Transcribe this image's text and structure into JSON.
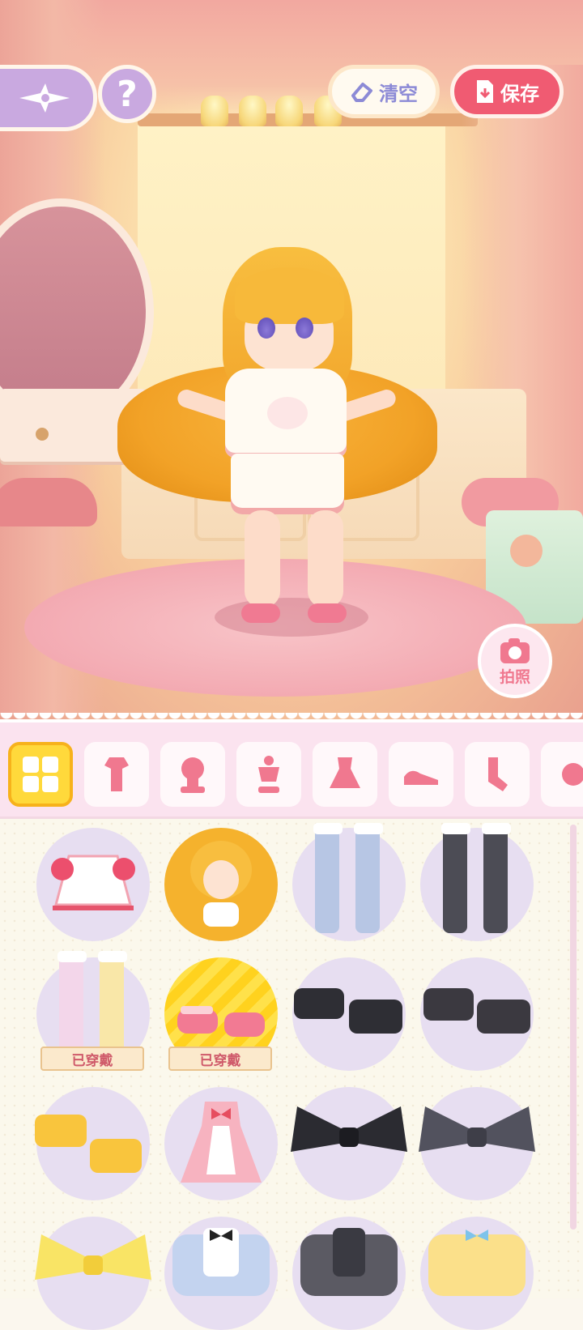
{
  "header": {
    "clear_label": "清空",
    "save_label": "保存",
    "help_label": "?"
  },
  "scene": {
    "photo_label": "拍照"
  },
  "categories": [
    {
      "icon": "all-items-icon",
      "active": true
    },
    {
      "icon": "outfit-set-icon",
      "active": false
    },
    {
      "icon": "hair-icon",
      "active": false
    },
    {
      "icon": "top-icon",
      "active": false
    },
    {
      "icon": "dress-icon",
      "active": false
    },
    {
      "icon": "shoes-icon",
      "active": false
    },
    {
      "icon": "socks-icon",
      "active": false
    },
    {
      "icon": "accessory-icon",
      "active": false
    }
  ],
  "items": [
    {
      "name": "pink-white-dress",
      "worn": false,
      "selected": false
    },
    {
      "name": "long-blonde-hair",
      "worn": false,
      "selected": false
    },
    {
      "name": "blue-argyle-stockings",
      "worn": false,
      "selected": false
    },
    {
      "name": "black-argyle-stockings",
      "worn": false,
      "selected": false
    },
    {
      "name": "pastel-argyle-stockings",
      "worn": true,
      "selected": false
    },
    {
      "name": "pink-slippers",
      "worn": true,
      "selected": true
    },
    {
      "name": "black-bow-boots",
      "worn": false,
      "selected": false
    },
    {
      "name": "dark-bow-boots",
      "worn": false,
      "selected": false
    },
    {
      "name": "yellow-bow-shoes",
      "worn": false,
      "selected": false
    },
    {
      "name": "pink-maid-dress",
      "worn": false,
      "selected": false
    },
    {
      "name": "black-hair-bow",
      "worn": false,
      "selected": false
    },
    {
      "name": "gray-hair-bow",
      "worn": false,
      "selected": false
    },
    {
      "name": "yellow-hair-bow",
      "worn": false,
      "selected": false
    },
    {
      "name": "blue-plaid-outfit",
      "worn": false,
      "selected": false
    },
    {
      "name": "gray-dark-outfit",
      "worn": false,
      "selected": false
    },
    {
      "name": "yellow-blue-outfit",
      "worn": false,
      "selected": false
    }
  ],
  "worn_label": "已穿戴",
  "colors": {
    "accent_pink": "#f05b72",
    "lavender": "#c9a9e0",
    "selected_yellow": "#ffd93b"
  }
}
